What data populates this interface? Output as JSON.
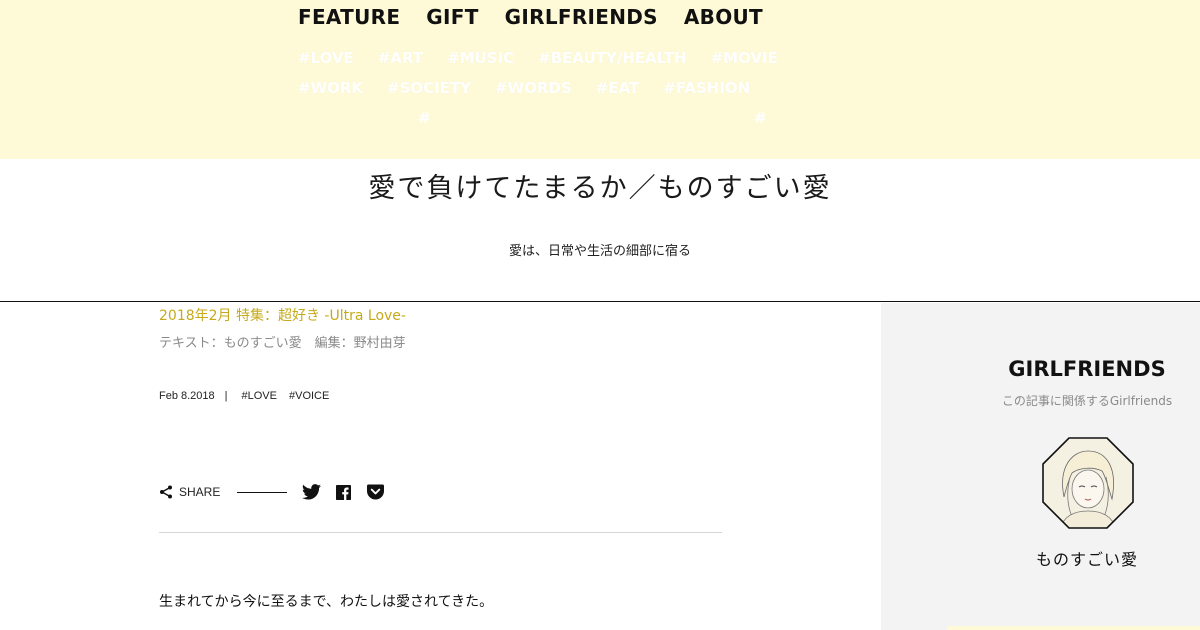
{
  "nav": {
    "main": [
      "FEATURE",
      "GIFT",
      "GIRLFRIENDS",
      "ABOUT"
    ],
    "tags_row1": [
      "#LOVE",
      "#ART",
      "#MUSIC",
      "#BEAUTY/HEALTH",
      "#MOVIE"
    ],
    "tags_row2": [
      "#WORK",
      "#SOCIETY",
      "#WORDS",
      "#EAT",
      "#FASHION"
    ],
    "lone_hash_left": "#",
    "lone_hash_right": "#"
  },
  "header": {
    "logo_text": "愛で負けてたまるか／ものすごい愛",
    "tagline": "愛は、日常や生活の細部に宿る"
  },
  "article": {
    "feature_link": "2018年2月 特集：超好き -Ultra Love-",
    "credits": "テキスト：ものすごい愛　編集：野村由芽",
    "date": "Feb 8.2018",
    "separator": "|",
    "tags": [
      "#LOVE",
      "#VOICE"
    ],
    "share_label": "SHARE",
    "body_first_line": "生まれてから今に至るまで、わたしは愛されてきた。"
  },
  "sidebar": {
    "title": "GIRLFRIENDS",
    "subtitle": "この記事に関係するGirlfriends",
    "person_name": "ものすごい愛"
  },
  "colors": {
    "nav_band": "#fefad7",
    "accent_gold": "#c6aa1b",
    "sidebar_bg": "#f3f3f3",
    "muted_text": "#8a8a8a"
  },
  "icons": [
    "share-icon",
    "twitter-icon",
    "facebook-icon",
    "pocket-icon"
  ]
}
